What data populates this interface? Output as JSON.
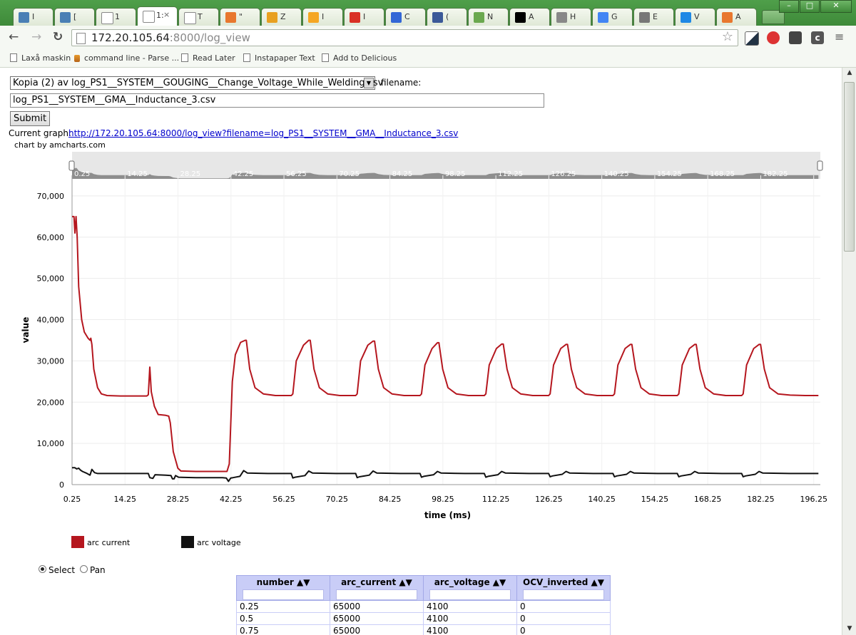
{
  "browser": {
    "tabs": [
      {
        "label": "I",
        "icon": "award-icon",
        "color": "#4a7fb5"
      },
      {
        "label": "[",
        "icon": "award-icon",
        "color": "#4a7fb5"
      },
      {
        "label": "1",
        "icon": "page-icon",
        "color": "#ffffff"
      },
      {
        "label": "1:",
        "icon": "page-icon",
        "color": "#ffffff",
        "active": true
      },
      {
        "label": "T",
        "icon": "page-icon",
        "color": "#ffffff"
      },
      {
        "label": "\"",
        "icon": "o-icon",
        "color": "#e8772e"
      },
      {
        "label": "Z",
        "icon": "z-icon",
        "color": "#e8a020"
      },
      {
        "label": "I",
        "icon": "circle-icon",
        "color": "#f5a623"
      },
      {
        "label": "I",
        "icon": "gmail-icon",
        "color": "#d93025"
      },
      {
        "label": "C",
        "icon": "calendar-icon",
        "color": "#3367d6"
      },
      {
        "label": "(",
        "icon": "facebook-icon",
        "color": "#3b5998"
      },
      {
        "label": "N",
        "icon": "flask-icon",
        "color": "#6aa84f"
      },
      {
        "label": "A",
        "icon": "vc-icon",
        "color": "#000000"
      },
      {
        "label": "H",
        "icon": "i-icon",
        "color": "#888888"
      },
      {
        "label": "G",
        "icon": "translate-icon",
        "color": "#4285f4"
      },
      {
        "label": "E",
        "icon": "grid-icon",
        "color": "#777777"
      },
      {
        "label": "V",
        "icon": "yr-icon",
        "color": "#1e88e5"
      },
      {
        "label": "A",
        "icon": "o-icon",
        "color": "#e8772e"
      }
    ],
    "url_host": "172.20.105.64",
    "url_rest": ":8000/log_view",
    "bookmarks": [
      "Laxå maskin",
      "command line - Parse ...",
      "Read Later",
      "Instapaper Text",
      "Add to Delicious"
    ]
  },
  "form": {
    "select_value": "Kopia (2) av log_PS1__SYSTEM__GOUGING__Change_Voltage_While_Welding.csv",
    "filename_label": "filename:",
    "filename_value": "log_PS1__SYSTEM__GMA__Inductance_3.csv",
    "submit_label": "Submit",
    "current_graph_label": "Current graph:",
    "current_graph_link": "http://172.20.105.64:8000/log_view?filename=log_PS1__SYSTEM__GMA__Inductance_3.csv",
    "credit": "chart by amcharts.com"
  },
  "chart_data": {
    "type": "line",
    "xlabel": "time (ms)",
    "ylabel": "value",
    "xlim": [
      0.25,
      198
    ],
    "ylim": [
      0,
      75000
    ],
    "x_ticks": [
      "0.25",
      "14.25",
      "28.25",
      "42.25",
      "56.25",
      "70.25",
      "84.25",
      "98.25",
      "112.25",
      "126.25",
      "140.25",
      "154.25",
      "168.25",
      "182.25",
      "196.25"
    ],
    "y_ticks": [
      "0",
      "10,000",
      "20,000",
      "30,000",
      "40,000",
      "50,000",
      "60,000",
      "70,000"
    ],
    "scrollbar_ticks": [
      "0.25",
      "14.25",
      "28.25",
      "42.25",
      "56.25",
      "70.25",
      "84.25",
      "98.25",
      "112.25",
      "126.25",
      "140.25",
      "154.25",
      "168.25",
      "182.25"
    ],
    "series": [
      {
        "name": "arc current",
        "color": "#b5161e",
        "points": [
          [
            0.25,
            65000
          ],
          [
            0.75,
            65000
          ],
          [
            1.0,
            61000
          ],
          [
            1.3,
            65000
          ],
          [
            1.6,
            60000
          ],
          [
            2.0,
            48000
          ],
          [
            2.8,
            40000
          ],
          [
            3.5,
            37000
          ],
          [
            4.5,
            35500
          ],
          [
            5.0,
            35000
          ],
          [
            5.2,
            35500
          ],
          [
            5.5,
            34000
          ],
          [
            6.0,
            28000
          ],
          [
            7.0,
            23500
          ],
          [
            8.0,
            22000
          ],
          [
            9.5,
            21600
          ],
          [
            13,
            21500
          ],
          [
            17,
            21500
          ],
          [
            20.0,
            21500
          ],
          [
            20.4,
            21800
          ],
          [
            20.8,
            28500
          ],
          [
            21.2,
            22500
          ],
          [
            22.0,
            19000
          ],
          [
            23.0,
            17000
          ],
          [
            25,
            16800
          ],
          [
            25.8,
            16600
          ],
          [
            26.2,
            15000
          ],
          [
            27,
            8000
          ],
          [
            28.2,
            4000
          ],
          [
            29,
            3300
          ],
          [
            33,
            3200
          ],
          [
            38,
            3200
          ],
          [
            41.2,
            3200
          ],
          [
            41.8,
            5000
          ],
          [
            42.6,
            25000
          ],
          [
            43.4,
            31500
          ],
          [
            44.8,
            34500
          ],
          [
            46,
            35000
          ],
          [
            46.3,
            35000
          ],
          [
            47.2,
            28000
          ],
          [
            48.6,
            23500
          ],
          [
            50.8,
            22000
          ],
          [
            54,
            21600
          ],
          [
            58.2,
            21600
          ],
          [
            58.6,
            22000
          ],
          [
            59.5,
            30000
          ],
          [
            61.4,
            33800
          ],
          [
            62.8,
            35000
          ],
          [
            63.2,
            35000
          ],
          [
            64.2,
            28000
          ],
          [
            65.6,
            23500
          ],
          [
            67.8,
            22000
          ],
          [
            71,
            21600
          ],
          [
            75.2,
            21600
          ],
          [
            75.6,
            22000
          ],
          [
            76.5,
            30000
          ],
          [
            78.4,
            33800
          ],
          [
            79.8,
            34800
          ],
          [
            80.2,
            34800
          ],
          [
            81.2,
            28000
          ],
          [
            82.6,
            23500
          ],
          [
            84.8,
            22000
          ],
          [
            88,
            21600
          ],
          [
            92.2,
            21600
          ],
          [
            92.6,
            22000
          ],
          [
            93.5,
            29000
          ],
          [
            95.4,
            33000
          ],
          [
            96.8,
            34400
          ],
          [
            97.2,
            34400
          ],
          [
            98.2,
            28000
          ],
          [
            99.6,
            23500
          ],
          [
            101.8,
            22000
          ],
          [
            105,
            21600
          ],
          [
            109.2,
            21600
          ],
          [
            109.6,
            22000
          ],
          [
            110.5,
            29000
          ],
          [
            112.4,
            33000
          ],
          [
            113.8,
            34100
          ],
          [
            114.2,
            34100
          ],
          [
            115.2,
            28000
          ],
          [
            116.6,
            23500
          ],
          [
            118.8,
            22000
          ],
          [
            122,
            21600
          ],
          [
            126.2,
            21600
          ],
          [
            126.6,
            22000
          ],
          [
            127.5,
            29000
          ],
          [
            129.4,
            33000
          ],
          [
            130.8,
            34000
          ],
          [
            131.2,
            34000
          ],
          [
            132.2,
            28000
          ],
          [
            133.6,
            23500
          ],
          [
            135.8,
            22000
          ],
          [
            139,
            21600
          ],
          [
            143.2,
            21600
          ],
          [
            143.6,
            22000
          ],
          [
            144.5,
            29000
          ],
          [
            146.4,
            33000
          ],
          [
            147.8,
            34000
          ],
          [
            148.2,
            34000
          ],
          [
            149.2,
            28000
          ],
          [
            150.6,
            23500
          ],
          [
            152.8,
            22000
          ],
          [
            156,
            21600
          ],
          [
            160.2,
            21600
          ],
          [
            160.6,
            22000
          ],
          [
            161.5,
            29000
          ],
          [
            163.4,
            33000
          ],
          [
            164.8,
            34000
          ],
          [
            165.2,
            34000
          ],
          [
            166.2,
            28000
          ],
          [
            167.6,
            23500
          ],
          [
            169.8,
            22000
          ],
          [
            173,
            21600
          ],
          [
            177.2,
            21600
          ],
          [
            177.6,
            22000
          ],
          [
            178.5,
            29000
          ],
          [
            180.4,
            33000
          ],
          [
            181.8,
            34000
          ],
          [
            182.2,
            34000
          ],
          [
            183.2,
            28000
          ],
          [
            184.6,
            23500
          ],
          [
            186.8,
            22000
          ],
          [
            190,
            21700
          ],
          [
            194,
            21600
          ],
          [
            197.5,
            21600
          ]
        ]
      },
      {
        "name": "arc voltage",
        "color": "#111111",
        "points": [
          [
            0.25,
            4100
          ],
          [
            1.0,
            4100
          ],
          [
            1.5,
            3800
          ],
          [
            2.0,
            4000
          ],
          [
            2.5,
            3500
          ],
          [
            3.0,
            3200
          ],
          [
            4.0,
            2800
          ],
          [
            5.0,
            2300
          ],
          [
            5.5,
            3700
          ],
          [
            6.2,
            2900
          ],
          [
            7.0,
            2700
          ],
          [
            10,
            2700
          ],
          [
            15,
            2700
          ],
          [
            20.4,
            2700
          ],
          [
            20.8,
            1700
          ],
          [
            21.6,
            1500
          ],
          [
            22.2,
            2400
          ],
          [
            25,
            2300
          ],
          [
            26.4,
            2200
          ],
          [
            26.8,
            1400
          ],
          [
            27.2,
            1400
          ],
          [
            27.6,
            2200
          ],
          [
            28.4,
            1800
          ],
          [
            33,
            1700
          ],
          [
            40,
            1700
          ],
          [
            41.0,
            1600
          ],
          [
            41.6,
            800
          ],
          [
            42.2,
            1600
          ],
          [
            42.8,
            1700
          ],
          [
            44.6,
            2000
          ],
          [
            45.6,
            3400
          ],
          [
            46.6,
            2800
          ],
          [
            52,
            2700
          ],
          [
            58.2,
            2700
          ],
          [
            58.6,
            1600
          ],
          [
            59.2,
            1800
          ],
          [
            61.8,
            2200
          ],
          [
            62.8,
            3300
          ],
          [
            63.8,
            2800
          ],
          [
            70,
            2700
          ],
          [
            75.2,
            2700
          ],
          [
            75.6,
            1700
          ],
          [
            76.2,
            1900
          ],
          [
            78.8,
            2300
          ],
          [
            79.8,
            3300
          ],
          [
            80.8,
            2800
          ],
          [
            87,
            2700
          ],
          [
            92.2,
            2700
          ],
          [
            92.6,
            1800
          ],
          [
            93.2,
            2000
          ],
          [
            95.8,
            2400
          ],
          [
            96.8,
            3200
          ],
          [
            97.8,
            2800
          ],
          [
            104,
            2700
          ],
          [
            109.2,
            2700
          ],
          [
            109.6,
            1800
          ],
          [
            110.2,
            2000
          ],
          [
            112.8,
            2400
          ],
          [
            113.8,
            3200
          ],
          [
            114.8,
            2800
          ],
          [
            121,
            2700
          ],
          [
            126.2,
            2700
          ],
          [
            126.6,
            1900
          ],
          [
            127.2,
            2100
          ],
          [
            129.8,
            2500
          ],
          [
            130.8,
            3200
          ],
          [
            131.8,
            2800
          ],
          [
            138,
            2700
          ],
          [
            143.2,
            2700
          ],
          [
            143.6,
            1900
          ],
          [
            144.2,
            2100
          ],
          [
            146.8,
            2500
          ],
          [
            147.8,
            3200
          ],
          [
            148.8,
            2800
          ],
          [
            155,
            2700
          ],
          [
            160.2,
            2700
          ],
          [
            160.6,
            1900
          ],
          [
            161.2,
            2100
          ],
          [
            163.8,
            2500
          ],
          [
            164.8,
            3200
          ],
          [
            165.8,
            2800
          ],
          [
            172,
            2700
          ],
          [
            177.2,
            2700
          ],
          [
            177.6,
            1900
          ],
          [
            178.2,
            2100
          ],
          [
            180.8,
            2500
          ],
          [
            181.8,
            3200
          ],
          [
            182.8,
            2800
          ],
          [
            190,
            2700
          ],
          [
            197.5,
            2700
          ]
        ]
      }
    ]
  },
  "legend": [
    {
      "label": "arc current",
      "color": "#b5161e"
    },
    {
      "label": "arc voltage",
      "color": "#111111"
    }
  ],
  "mode": {
    "select_label": "Select",
    "pan_label": "Pan",
    "selected": "select"
  },
  "table": {
    "columns": [
      "number ▲▼",
      "arc_current ▲▼",
      "arc_voltage ▲▼",
      "OCV_inverted ▲▼"
    ],
    "rows": [
      [
        "0.25",
        "65000",
        "4100",
        "0"
      ],
      [
        "0.5",
        "65000",
        "4100",
        "0"
      ],
      [
        "0.75",
        "65000",
        "4100",
        "0"
      ]
    ]
  }
}
